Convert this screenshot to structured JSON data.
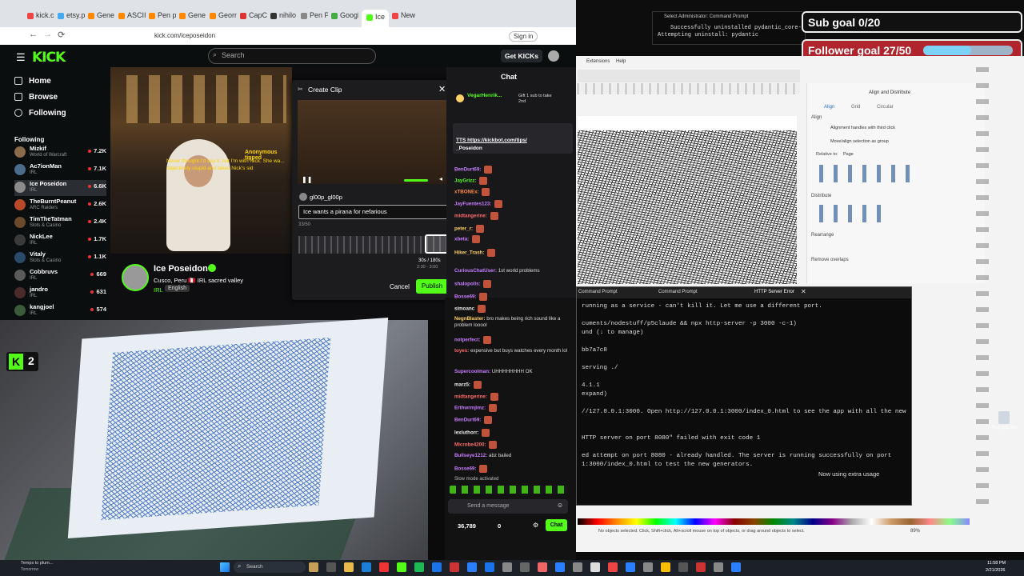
{
  "browser": {
    "tabs": [
      "kick.c",
      "etsy.p",
      "Gene",
      "ASCII",
      "Pen p",
      "Gene",
      "Georn",
      "CapC",
      "nihilo",
      "Pen Plotte",
      "Googl",
      "Ice",
      "New"
    ],
    "url": "kick.com/iceposeidon",
    "signin": "Sign in"
  },
  "kick": {
    "logo": "KICK",
    "search_placeholder": "Search",
    "get_kicks": "Get KICKs",
    "nav": [
      "Home",
      "Browse",
      "Following"
    ],
    "following_header": "Following",
    "following": [
      {
        "name": "Mizkif",
        "category": "World of Warcraft",
        "viewers": "7.2K",
        "color": "#8a6b4a"
      },
      {
        "name": "Ac7ionMan",
        "category": "IRL",
        "viewers": "7.1K",
        "color": "#4a6b8a"
      },
      {
        "name": "Ice Poseidon",
        "category": "IRL",
        "viewers": "6.6K",
        "color": "#8b8b8b"
      },
      {
        "name": "TheBurntPeanut",
        "category": "ARC Raiders",
        "viewers": "2.6K",
        "color": "#b84a2a"
      },
      {
        "name": "TimTheTatman",
        "category": "Slots & Casino",
        "viewers": "2.4K",
        "color": "#6a4a2a"
      },
      {
        "name": "NickLee",
        "category": "IRL",
        "viewers": "1.7K",
        "color": "#3a3a3a"
      },
      {
        "name": "Vitaly",
        "category": "Slots & Casino",
        "viewers": "1.1K",
        "color": "#2a4a6a"
      },
      {
        "name": "Cobbruvs",
        "category": "IRL",
        "viewers": "669",
        "color": "#5a5a5a"
      },
      {
        "name": "jandro",
        "category": "IRL",
        "viewers": "631",
        "color": "#4a2a2a"
      },
      {
        "name": "kangjoel",
        "category": "IRL",
        "viewers": "574",
        "color": "#3a5a3a"
      }
    ],
    "stream": {
      "name": "Ice Poseidon",
      "title": "Cusco, Peru 🇵🇪 IRL sacred valley",
      "category": "IRL",
      "language": "English",
      "overlay_text": "Never thought I'd say it, but I'm with Nick. She wa... objectively stupid and takes Nick's sid",
      "overlay_label": "Anonymous tipped"
    },
    "clip": {
      "title": "Create Clip",
      "user": "gl00p_gl00p",
      "input": "Ice wants a pirana for nefarious",
      "counter": "33/50",
      "duration": "30s / 180s",
      "range": "2:30 - 3:00",
      "cancel": "Cancel",
      "publish": "Publish"
    },
    "chat": {
      "header": "Chat",
      "pinned_user": "VegarHenrik...",
      "pinned_sub": "Gift 1 sub to take 2nd",
      "tts_label": "TTS https://kickbot.com/tips/",
      "tts_user": "_Poseidon",
      "messages": [
        {
          "user": "BenDurt69:",
          "text": "",
          "color": "#c77dff"
        },
        {
          "user": "JayGrizz:",
          "text": "",
          "color": "#53fc18"
        },
        {
          "user": "xTBONEx:",
          "text": "",
          "color": "#ff8c42"
        },
        {
          "user": "JayFuentes123:",
          "text": "",
          "color": "#c77dff"
        },
        {
          "user": "midtangerine:",
          "text": "",
          "color": "#ff6b6b"
        },
        {
          "user": "peter_r:",
          "text": "",
          "color": "#ffd166"
        },
        {
          "user": "xbeta:",
          "text": "",
          "color": "#c77dff"
        },
        {
          "user": "Hiker_Trash:",
          "text": "",
          "color": "#ffd166"
        },
        {
          "user": "CuriousChatUser:",
          "text": "1st world problems",
          "color": "#c77dff"
        },
        {
          "user": "shalopolis:",
          "text": "",
          "color": "#c77dff"
        },
        {
          "user": "Bosse69:",
          "text": "",
          "color": "#c77dff"
        },
        {
          "user": "simoanc",
          "text": "",
          "color": "#eee"
        },
        {
          "user": "NegnBlaster:",
          "text": "bro makes being rich sound like a problem looool",
          "color": "#ffd166"
        },
        {
          "user": "notperfect:",
          "text": "",
          "color": "#c77dff"
        },
        {
          "user": "toyes:",
          "text": "expensive but buys watches every month lol",
          "color": "#ff6b6b"
        },
        {
          "user": "Supercoolman:",
          "text": "UHHHHHHHH OK",
          "color": "#c77dff"
        },
        {
          "user": "marz5:",
          "text": "",
          "color": "#eee"
        },
        {
          "user": "midtangerine:",
          "text": "",
          "color": "#ff6b6b"
        },
        {
          "user": "Erthwrmjimz:",
          "text": "",
          "color": "#c77dff"
        },
        {
          "user": "BenDurt69:",
          "text": "",
          "color": "#c77dff"
        },
        {
          "user": "lexluthorr:",
          "text": "",
          "color": "#eee"
        },
        {
          "user": "Microbe4200:",
          "text": "",
          "color": "#ff6b6b"
        },
        {
          "user": "Bullseye1212:",
          "text": "abz bailed",
          "color": "#c77dff"
        },
        {
          "user": "Bosse69:",
          "text": "",
          "color": "#c77dff"
        }
      ],
      "slow_mode": "Slow mode activated",
      "send_placeholder": "Send a message",
      "kicks_count": "36,789",
      "gifts_count": "0",
      "chat_button": "Chat"
    }
  },
  "overlays": {
    "sub_goal": "Sub goal 0/20",
    "follower_goal": "Follower goal 27/50",
    "follower_progress": 0.54,
    "badge_count": "2"
  },
  "cmd_top": {
    "title": "Select Administrator: Command Prompt",
    "lines": [
      "Successfully uninstalled pydantic_core-2",
      "Attempting uninstall: pydantic"
    ]
  },
  "inkscape": {
    "menu": [
      "Extensions",
      "Help"
    ],
    "panel_tab": "Align and Distribute",
    "modes": [
      "Align",
      "Grid",
      "Circular"
    ],
    "align_label": "Align",
    "options": [
      "Alignment handles with third click",
      "Move/align selection as group"
    ],
    "relative_to": "Relative to:",
    "relative_value": "Page",
    "distribute": "Distribute",
    "rearrange": "Rearrange",
    "remove_overlaps": "Remove overlaps",
    "status": "No objects selected. Click, Shift+click, Alt+scroll mouse on top of objects, or drag around objects to select.",
    "zoom": "89%"
  },
  "terminal": {
    "tabs": [
      "Command Prompt",
      "Command Prompt",
      "HTTP Server Error"
    ],
    "lines": [
      "running as a service - can't kill it. Let me use a different port.",
      "",
      "cuments/nodestuff/p5claude && npx http-server -p 3000 -c-1)",
      "und (↓ to manage)",
      "",
      "bb7a7c8",
      "",
      "serving ./",
      "",
      "4.1.1",
      "expand)",
      "",
      "//127.0.0.1:3000. Open http://127.0.0.1:3000/index_0.html to see the app with all the new",
      "",
      "",
      "HTTP server on port 8080\" failed with exit code 1",
      "",
      "ed attempt on port 8080 - already handled. The server is running successfully on port",
      "1:3000/index_0.html to test the new generators."
    ],
    "status": "Now using extra usage"
  },
  "taskbar": {
    "weather": "Temps to plum...",
    "weather_sub": "Tomorrow",
    "search": "Search",
    "time": "11:58 PM",
    "date": "2/21/2026"
  },
  "desktop": {
    "recycle": "Recycle Bin"
  }
}
